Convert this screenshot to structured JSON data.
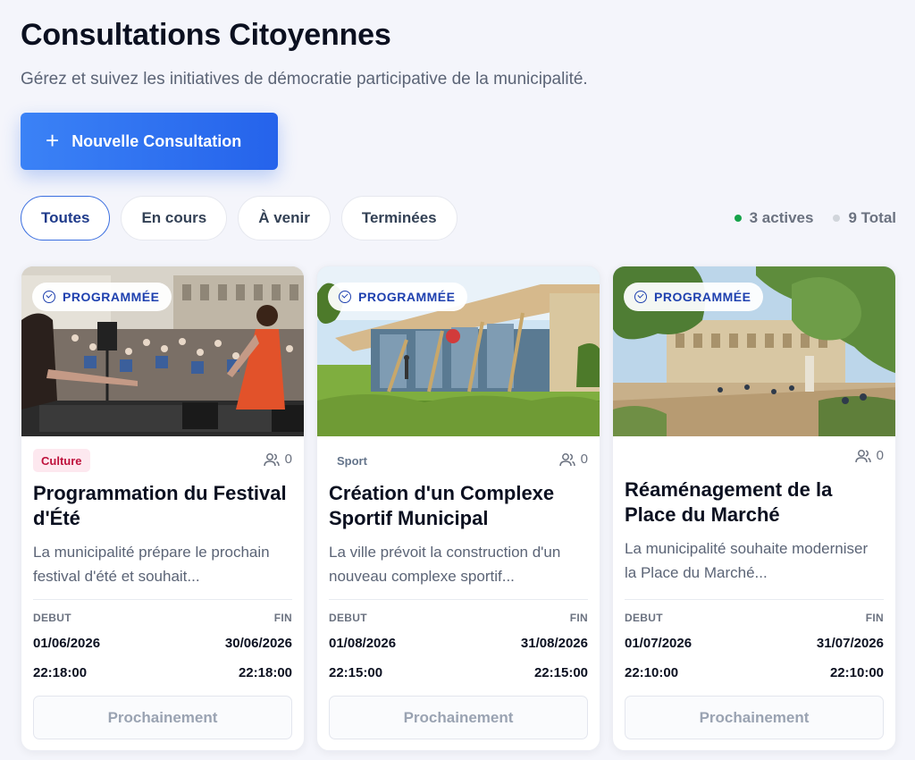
{
  "header": {
    "title": "Consultations Citoyennes",
    "subtitle": "Gérez et suivez les initiatives de démocratie participative de la municipalité."
  },
  "actions": {
    "new_label": "Nouvelle Consultation"
  },
  "filters": [
    "Toutes",
    "En cours",
    "À venir",
    "Terminées"
  ],
  "active_filter": "Toutes",
  "stats": {
    "active": "3 actives",
    "total": "9 Total"
  },
  "colors": {
    "accent": "#2563eb",
    "active_dot": "#16a34a",
    "culture": "#be123c"
  },
  "cards": [
    {
      "status": "PROGRAMMÉE",
      "category": "Culture",
      "participants": "0",
      "title": "Programmation du Festival d'Été",
      "description": "La municipalité prépare le prochain festival d'été et souhait...",
      "start_label": "DEBUT",
      "end_label": "FIN",
      "start_date": "01/06/2026",
      "end_date": "30/06/2026",
      "start_time": "22:18:00",
      "end_time": "22:18:00",
      "button": "Prochainement"
    },
    {
      "status": "PROGRAMMÉE",
      "category": "Sport",
      "participants": "0",
      "title": "Création d'un Complexe Sportif Municipal",
      "description": "La ville prévoit la construction d'un nouveau complexe sportif...",
      "start_label": "DEBUT",
      "end_label": "FIN",
      "start_date": "01/08/2026",
      "end_date": "31/08/2026",
      "start_time": "22:15:00",
      "end_time": "22:15:00",
      "button": "Prochainement"
    },
    {
      "status": "PROGRAMMÉE",
      "category": "",
      "participants": "0",
      "title": "Réaménagement de la Place du Marché",
      "description": "La municipalité souhaite moderniser la Place du Marché...",
      "start_label": "DEBUT",
      "end_label": "FIN",
      "start_date": "01/07/2026",
      "end_date": "31/07/2026",
      "start_time": "22:10:00",
      "end_time": "22:10:00",
      "button": "Prochainement"
    }
  ]
}
